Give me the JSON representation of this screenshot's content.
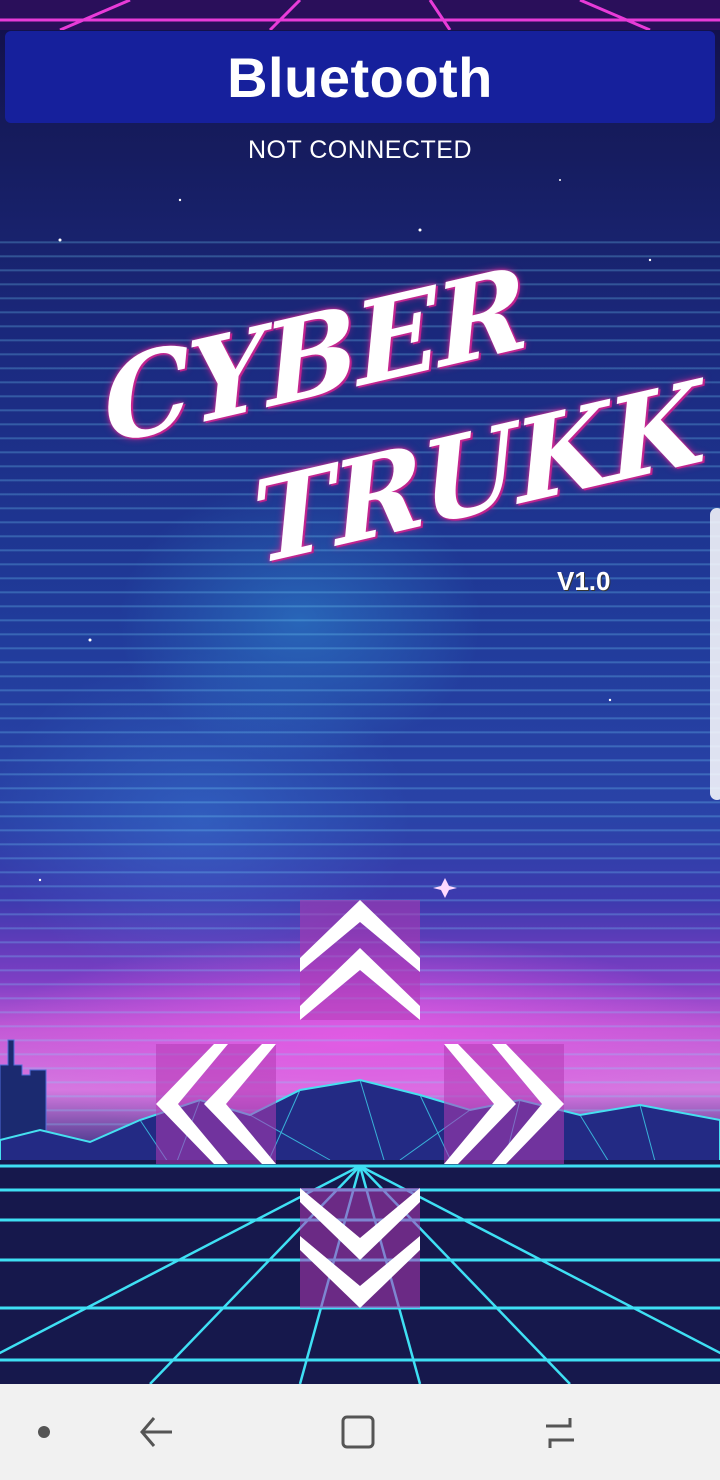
{
  "header": {
    "title": "Bluetooth",
    "status": "NOT CONNECTED"
  },
  "logo": {
    "line1": "CYBER",
    "line2": "TRUKK",
    "version": "V1.0"
  },
  "controls": {
    "up_icon": "double-chevron-up-icon",
    "left_icon": "double-chevron-left-icon",
    "right_icon": "double-chevron-right-icon",
    "down_icon": "double-chevron-down-icon"
  },
  "nav_bar": {
    "dot_icon": "dot-icon",
    "back_icon": "back-icon",
    "home_icon": "home-icon",
    "recents_icon": "recents-icon",
    "background_color": "#f1f1f1"
  },
  "colors": {
    "header_bg": "#16209c",
    "chevron": "#ffffff",
    "chevron_shadow": "#b23bb4"
  }
}
